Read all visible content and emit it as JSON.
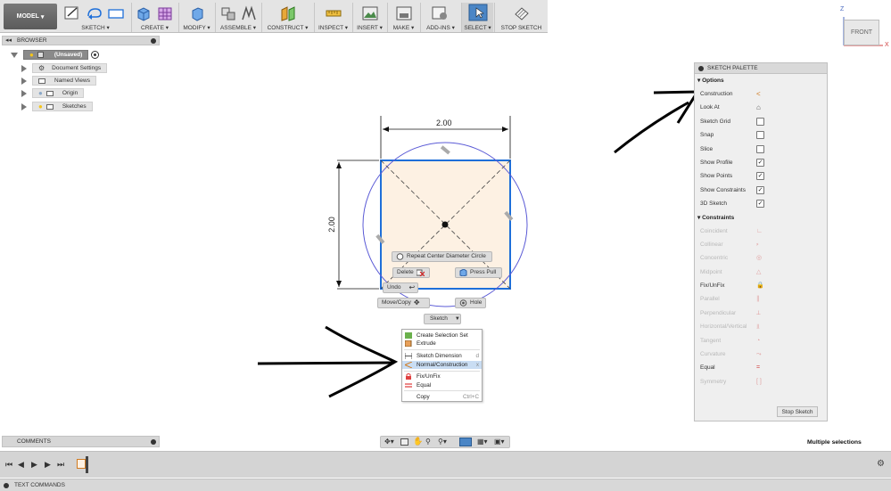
{
  "toolbar": {
    "mode": "MODEL",
    "groups": [
      {
        "label": "SKETCH ▾"
      },
      {
        "label": "CREATE ▾"
      },
      {
        "label": "MODIFY ▾"
      },
      {
        "label": "ASSEMBLE ▾"
      },
      {
        "label": "CONSTRUCT ▾"
      },
      {
        "label": "INSPECT ▾"
      },
      {
        "label": "INSERT ▾"
      },
      {
        "label": "MAKE ▾"
      },
      {
        "label": "ADD-INS ▾"
      },
      {
        "label": "SELECT ▾"
      },
      {
        "label": "STOP SKETCH"
      }
    ]
  },
  "browser": {
    "title": "BROWSER",
    "items": [
      {
        "label": "(Unsaved)"
      },
      {
        "label": "Document Settings"
      },
      {
        "label": "Named Views"
      },
      {
        "label": "Origin"
      },
      {
        "label": "Sketches"
      }
    ]
  },
  "viewcube": {
    "label": "FRONT",
    "axis_z": "Z",
    "axis_x": "X"
  },
  "sketch": {
    "dim_horizontal": "2.00",
    "dim_vertical": "2.00"
  },
  "marking_menu": {
    "repeat": "Repeat Center Diameter Circle",
    "delete": "Delete",
    "press_pull": "Press Pull",
    "undo": "Undo",
    "move_copy": "Move/Copy",
    "hole": "Hole",
    "sketch": "Sketch"
  },
  "context_menu": {
    "items": [
      {
        "label": "Create Selection Set",
        "key": ""
      },
      {
        "label": "Extrude",
        "key": ""
      },
      {
        "label": "Sketch Dimension",
        "key": "d"
      },
      {
        "label": "Normal/Construction",
        "key": "x"
      },
      {
        "label": "Fix/UnFix",
        "key": ""
      },
      {
        "label": "Equal",
        "key": ""
      },
      {
        "label": "Copy",
        "key": "Ctrl+C"
      }
    ]
  },
  "palette": {
    "title": "SKETCH PALETTE",
    "options_title": "Options",
    "options": [
      {
        "label": "Construction",
        "control": "construction-icon"
      },
      {
        "label": "Look At",
        "control": "look-at-icon"
      },
      {
        "label": "Sketch Grid",
        "control": "checkbox",
        "checked": false
      },
      {
        "label": "Snap",
        "control": "checkbox",
        "checked": false
      },
      {
        "label": "Slice",
        "control": "checkbox",
        "checked": false
      },
      {
        "label": "Show Profile",
        "control": "checkbox",
        "checked": true
      },
      {
        "label": "Show Points",
        "control": "checkbox",
        "checked": true
      },
      {
        "label": "Show Constraints",
        "control": "checkbox",
        "checked": true
      },
      {
        "label": "3D Sketch",
        "control": "checkbox",
        "checked": true
      }
    ],
    "constraints_title": "Constraints",
    "constraints": [
      {
        "label": "Coincident",
        "enabled": false
      },
      {
        "label": "Collinear",
        "enabled": false
      },
      {
        "label": "Concentric",
        "enabled": false
      },
      {
        "label": "Midpoint",
        "enabled": false
      },
      {
        "label": "Fix/UnFix",
        "enabled": true
      },
      {
        "label": "Parallel",
        "enabled": false
      },
      {
        "label": "Perpendicular",
        "enabled": false
      },
      {
        "label": "Horizontal/Vertical",
        "enabled": false
      },
      {
        "label": "Tangent",
        "enabled": false
      },
      {
        "label": "Curvature",
        "enabled": false
      },
      {
        "label": "Equal",
        "enabled": true
      },
      {
        "label": "Symmetry",
        "enabled": false
      }
    ],
    "stop_label": "Stop Sketch"
  },
  "comments": {
    "title": "COMMENTS"
  },
  "status": {
    "text": "Multiple selections"
  },
  "textcommands": {
    "title": "TEXT COMMANDS"
  },
  "colors": {
    "accent": "#1e6fd9",
    "sketch_fill": "#fdf1e3",
    "circle": "#5b5bd6",
    "highlight": "#c9ddf3"
  }
}
